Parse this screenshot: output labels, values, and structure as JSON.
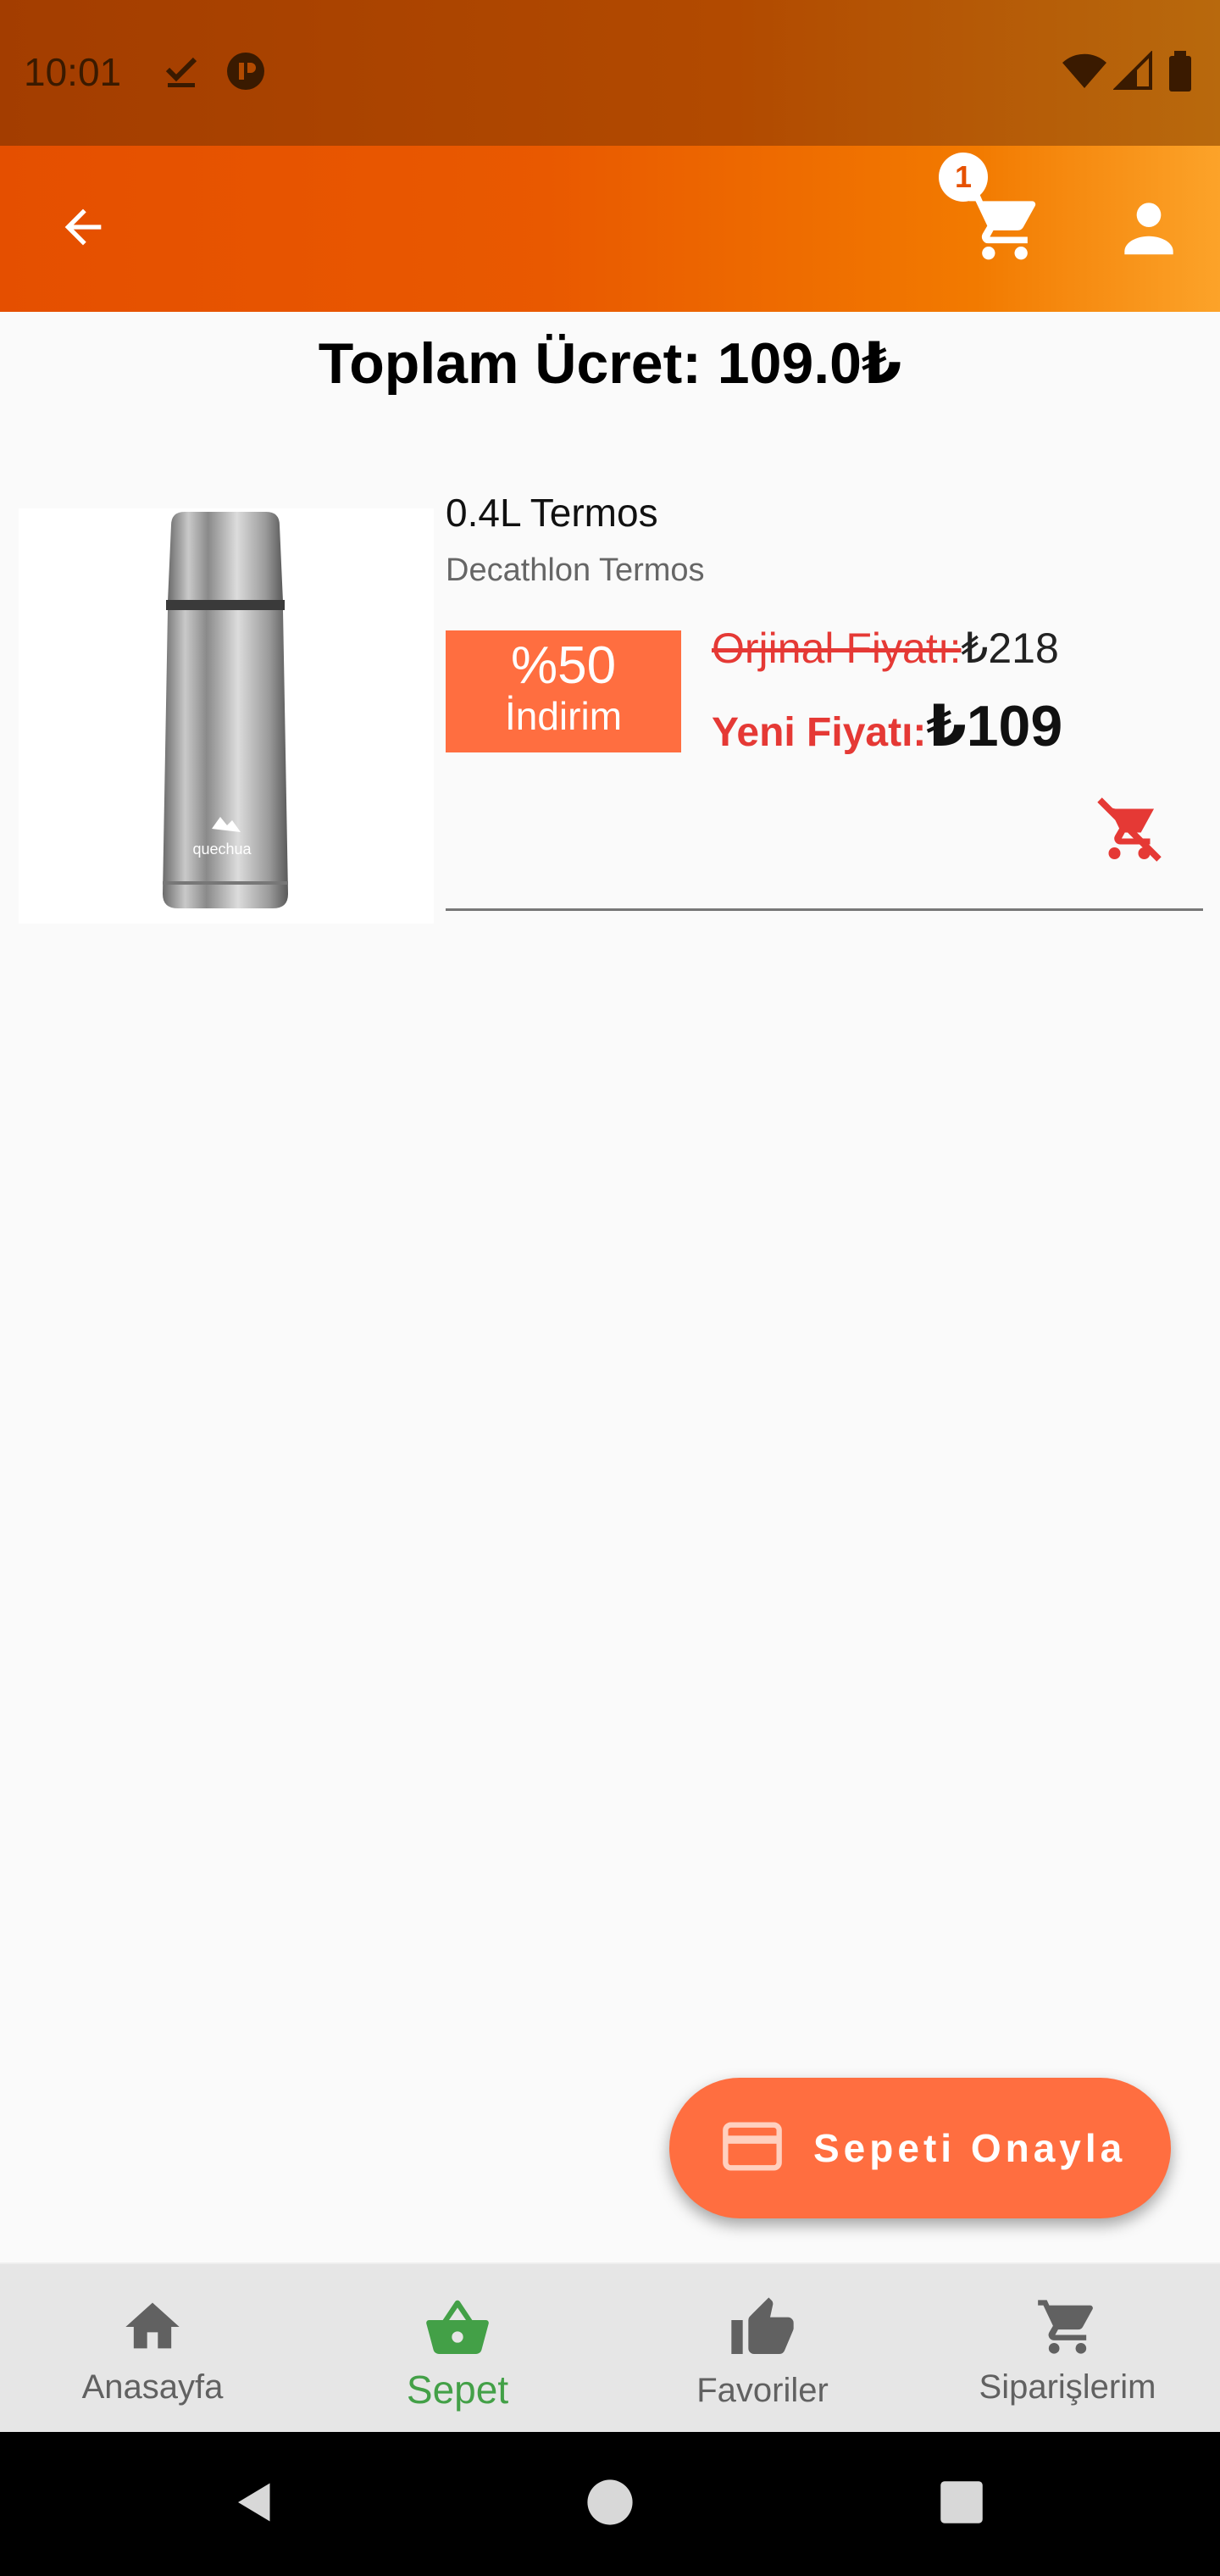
{
  "status_bar": {
    "time": "10:01",
    "icons": [
      "check-download-icon",
      "app-circle-icon",
      "wifi-icon",
      "signal-icon",
      "battery-icon"
    ]
  },
  "app_bar": {
    "back_icon": "arrow-back-icon",
    "cart_icon": "shopping-cart-icon",
    "cart_count": "1",
    "profile_icon": "person-icon"
  },
  "cart": {
    "total_label": "Toplam Ücret: 109.0₺",
    "items": [
      {
        "name": "0.4L Termos",
        "brand": "Decathlon Termos",
        "discount_percent": "%50",
        "discount_label": "İndirim",
        "original_price_label": "Orjinal Fiyatı:",
        "original_price_value": "₺218",
        "new_price_label": "Yeni Fiyatı:",
        "new_price_value": "₺109",
        "image_logo_text": "quechua",
        "remove_icon": "remove-shopping-cart-icon"
      }
    ]
  },
  "fab": {
    "label": "Sepeti Onayla",
    "icon": "credit-card-icon"
  },
  "bottom_nav": {
    "items": [
      {
        "label": "Anasayfa",
        "icon": "home-icon",
        "active": false
      },
      {
        "label": "Sepet",
        "icon": "basket-icon",
        "active": true
      },
      {
        "label": "Favoriler",
        "icon": "thumb-up-icon",
        "active": false
      },
      {
        "label": "Siparişlerim",
        "icon": "shopping-cart-icon",
        "active": false
      }
    ]
  },
  "colors": {
    "accent": "#ff6e40",
    "price_red": "#e53935",
    "active_nav": "#43a047",
    "appbar_start": "#e54f00",
    "appbar_end": "#fca329"
  }
}
